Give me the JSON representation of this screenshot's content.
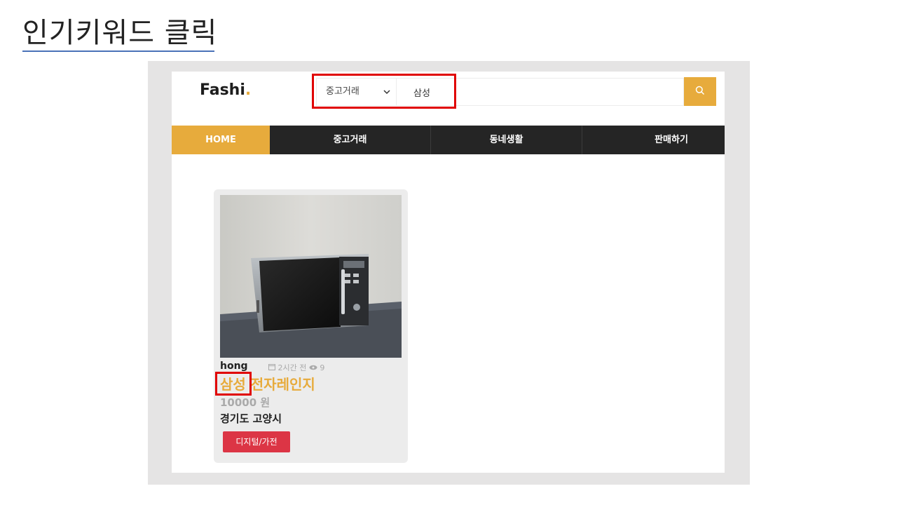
{
  "slide": {
    "title": "인기키워드 클릭"
  },
  "header": {
    "logo_text": "Fashi",
    "logo_dot": ".",
    "search_category": "중고거래",
    "search_value": "삼성",
    "search_icon": "search-icon"
  },
  "nav": {
    "items": [
      "HOME",
      "중고거래",
      "동네생활",
      "판매하기"
    ]
  },
  "product": {
    "user": "hong",
    "time": "2시간 전",
    "views": "9",
    "title_keyword": "삼성",
    "title_rest": " 전자레인지",
    "price": "10000 원",
    "location": "경기도 고양시",
    "category_tag": "디지털/가전"
  },
  "colors": {
    "accent": "#e7ab3c",
    "nav_bg": "#252525",
    "tag": "#dc3545",
    "annotation": "#e00000",
    "underline": "#4a72b8"
  }
}
